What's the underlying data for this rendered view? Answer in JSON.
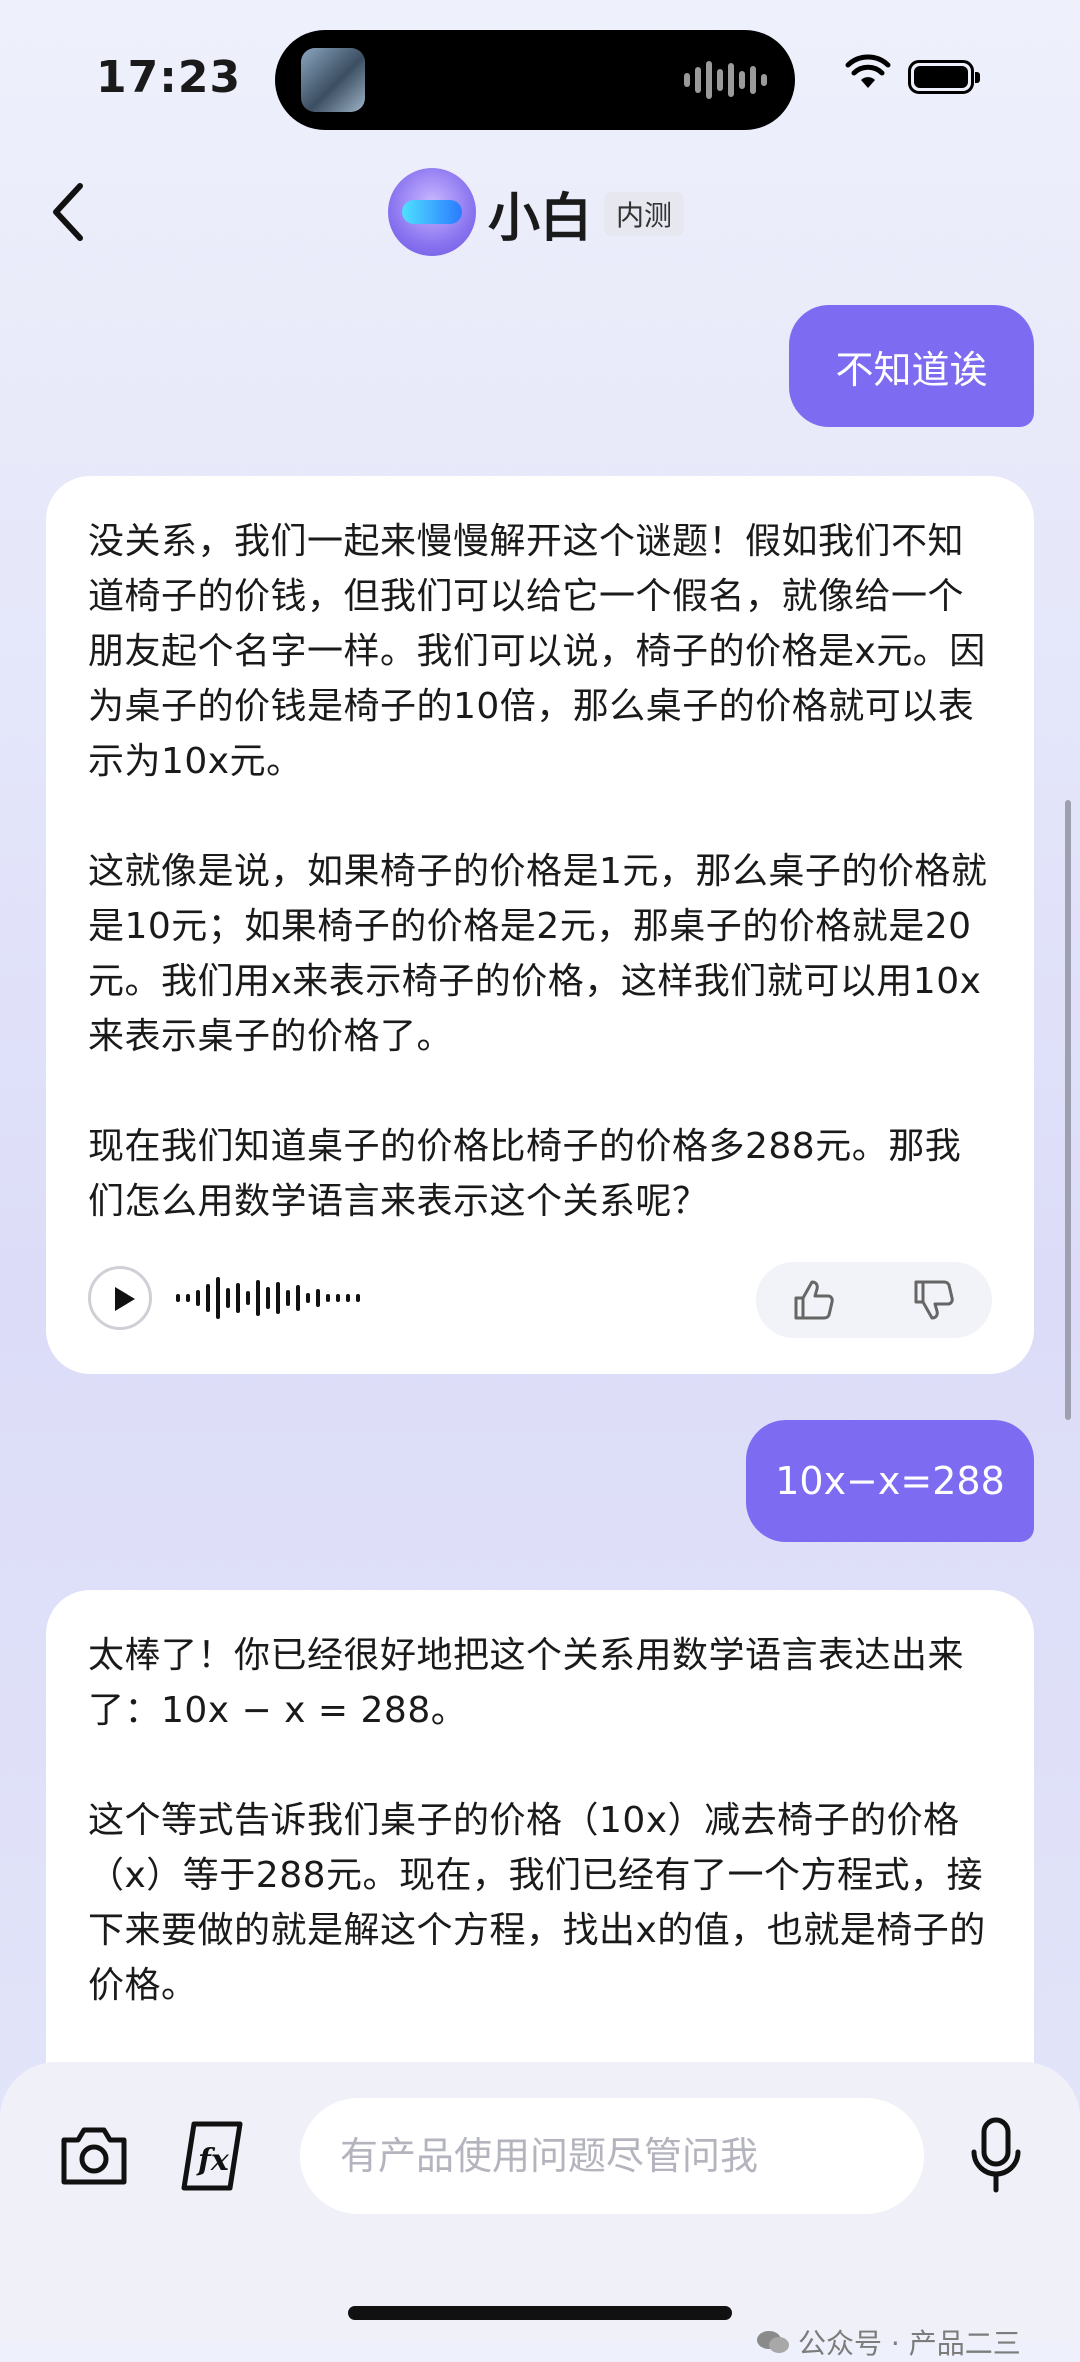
{
  "status_bar": {
    "time": "17:23"
  },
  "header": {
    "title": "小白",
    "badge": "内测"
  },
  "messages": [
    {
      "role": "user",
      "text": "不知道诶"
    },
    {
      "role": "bot",
      "paragraphs": [
        "没关系，我们一起来慢慢解开这个谜题！假如我们不知道椅子的价钱，但我们可以给它一个假名，就像给一个朋友起个名字一样。我们可以说，椅子的价格是x元。因为桌子的价钱是椅子的10倍，那么桌子的价格就可以表示为10x元。",
        "这就像是说，如果椅子的价格是1元，那么桌子的价格就是10元；如果椅子的价格是2元，那桌子的价格就是20元。我们用x来表示椅子的价格，这样我们就可以用10x来表示桌子的价格了。",
        "现在我们知道桌子的价格比椅子的价格多288元。那我们怎么用数学语言来表示这个关系呢？"
      ]
    },
    {
      "role": "user",
      "text": "10x−x=288"
    },
    {
      "role": "bot",
      "paragraphs": [
        "太棒了！你已经很好地把这个关系用数学语言表达出来了：10x − x = 288。",
        "这个等式告诉我们桌子的价格（10x）减去椅子的价格（x）等于288元。现在，我们已经有了一个方程式，接下来要做的就是解这个方程，找出x的值，也就是椅子的价格。"
      ]
    }
  ],
  "input": {
    "placeholder": "有产品使用问题尽管问我"
  },
  "watermark": "公众号 · 产品二三",
  "colors": {
    "accent": "#7d6cf2",
    "card": "#ffffff",
    "background": "#e4e6fa"
  },
  "icons": [
    "back-icon",
    "play-icon",
    "thumbs-up-icon",
    "thumbs-down-icon",
    "camera-icon",
    "formula-icon",
    "microphone-icon",
    "wifi-icon",
    "battery-icon"
  ]
}
